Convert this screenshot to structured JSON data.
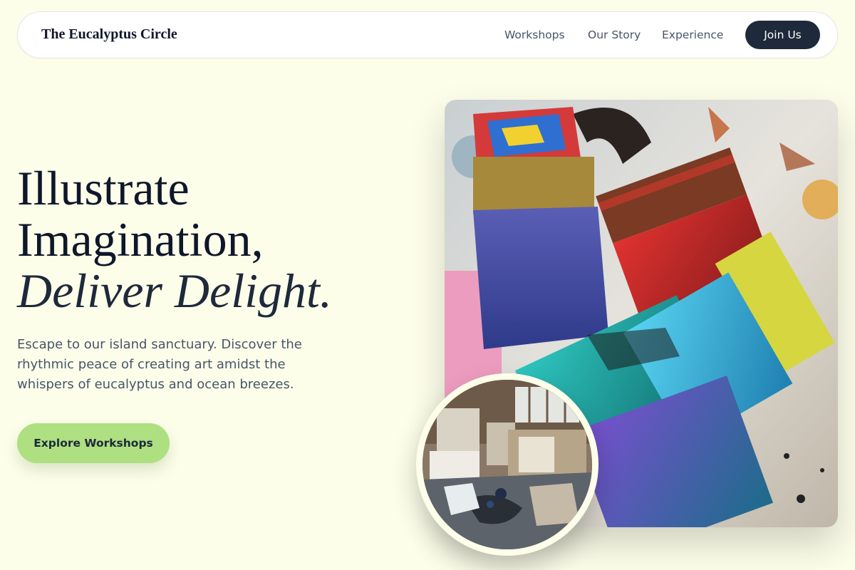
{
  "brand": {
    "name": "The Eucalyptus Circle"
  },
  "nav": {
    "links": [
      "Workshops",
      "Our Story",
      "Experience"
    ],
    "cta_label": "Join Us"
  },
  "hero": {
    "headline_line1": "Illustrate",
    "headline_line2": "Imagination,",
    "headline_line3": "Deliver Delight.",
    "subcopy": "Escape to our island sanctuary. Discover the rhythmic peace of creating art amidst the whispers of eucalyptus and ocean breezes.",
    "cta_label": "Explore Workshops"
  },
  "images": {
    "main_subject": "paint-brushes-photo",
    "inset_subject": "art-studio-photo"
  },
  "colors": {
    "page_background": "#fdfeea",
    "dark_navy": "#1e293b",
    "accent_green": "#aedf80",
    "muted_text": "#475569"
  }
}
